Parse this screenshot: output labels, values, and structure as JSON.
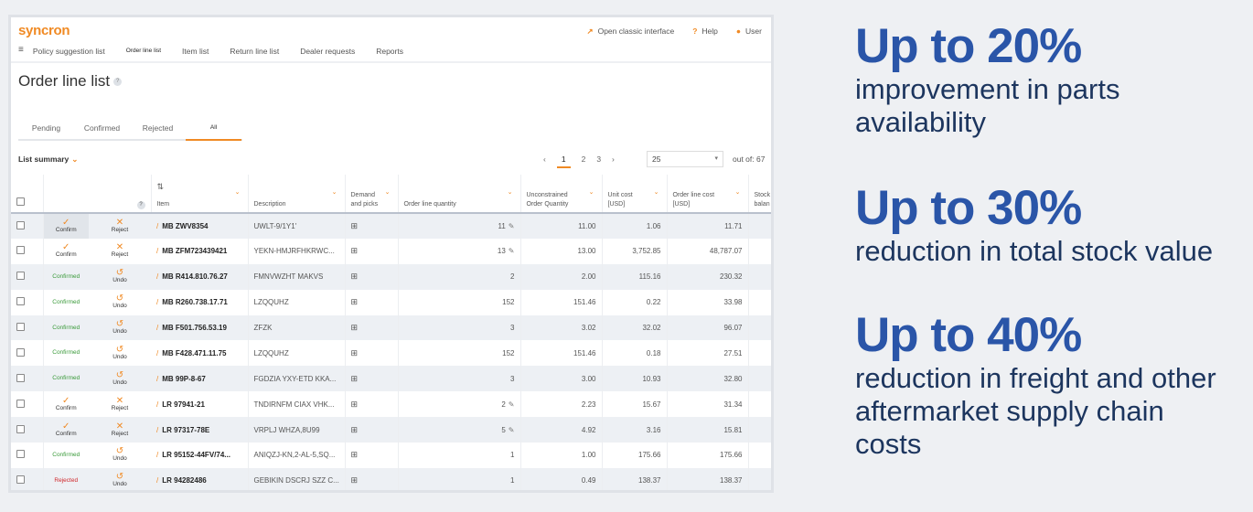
{
  "app": {
    "logo": "syncron",
    "open_classic": "Open classic interface",
    "help": "Help",
    "user": "User"
  },
  "nav": [
    "Policy suggestion list",
    "Order line list",
    "Item list",
    "Return line list",
    "Dealer requests",
    "Reports"
  ],
  "page": {
    "title": "Order line list",
    "help_badge": "?"
  },
  "tabs": [
    "Pending",
    "Confirmed",
    "Rejected",
    "All"
  ],
  "active_tab": "All",
  "list_summary": "List summary",
  "pagination": {
    "pages": [
      "1",
      "2",
      "3"
    ],
    "current": "1",
    "per_page": "25",
    "out_of": "out of: 67"
  },
  "columns": {
    "help": "?",
    "sort": "⇅",
    "item": "Item",
    "description": "Description",
    "demand": "Demand and picks",
    "qty": "Order line quantity",
    "uncons": "Unconstrained Order Quantity",
    "unit": "Unit cost [USD]",
    "cost": "Order line cost [USD]",
    "stock": "Stock balan"
  },
  "labels": {
    "confirm": "Confirm",
    "reject": "Reject",
    "undo": "Undo",
    "confirmed": "Confirmed",
    "rejected": "Rejected"
  },
  "rows": [
    {
      "status": "pending",
      "item": "MB ZWV8354",
      "desc": "UWLT-9/1Y1'",
      "qty": "11",
      "editable": true,
      "uncons": "11.00",
      "unit": "1.06",
      "cost": "11.71"
    },
    {
      "status": "pending",
      "item": "MB ZFM723439421",
      "desc": "YEKN-HMJRFHKRWC...",
      "qty": "13",
      "editable": true,
      "uncons": "13.00",
      "unit": "3,752.85",
      "cost": "48,787.07"
    },
    {
      "status": "confirmed",
      "item": "MB R414.810.76.27",
      "desc": "FMNVWZHT MAKVS",
      "qty": "2",
      "editable": false,
      "uncons": "2.00",
      "unit": "115.16",
      "cost": "230.32"
    },
    {
      "status": "confirmed",
      "item": "MB R260.738.17.71",
      "desc": "LZQQUHZ",
      "qty": "152",
      "editable": false,
      "uncons": "151.46",
      "unit": "0.22",
      "cost": "33.98"
    },
    {
      "status": "confirmed",
      "item": "MB F501.756.53.19",
      "desc": "ZFZK",
      "qty": "3",
      "editable": false,
      "uncons": "3.02",
      "unit": "32.02",
      "cost": "96.07"
    },
    {
      "status": "confirmed",
      "item": "MB F428.471.11.75",
      "desc": "LZQQUHZ",
      "qty": "152",
      "editable": false,
      "uncons": "151.46",
      "unit": "0.18",
      "cost": "27.51"
    },
    {
      "status": "confirmed",
      "item": "MB 99P-8-67",
      "desc": "FGDZIA YXY-ETD KKA...",
      "qty": "3",
      "editable": false,
      "uncons": "3.00",
      "unit": "10.93",
      "cost": "32.80"
    },
    {
      "status": "pending",
      "item": "LR 97941-21",
      "desc": "TNDIRNFM CIAX VHK...",
      "qty": "2",
      "editable": true,
      "uncons": "2.23",
      "unit": "15.67",
      "cost": "31.34"
    },
    {
      "status": "pending",
      "item": "LR 97317-78E",
      "desc": "VRPLJ WHZA,8U99",
      "qty": "5",
      "editable": true,
      "uncons": "4.92",
      "unit": "3.16",
      "cost": "15.81"
    },
    {
      "status": "confirmed",
      "item": "LR 95152-44FV/74...",
      "desc": "ANIQZJ-KN,2-AL-5,SQ...",
      "qty": "1",
      "editable": false,
      "uncons": "1.00",
      "unit": "175.66",
      "cost": "175.66"
    },
    {
      "status": "rejected",
      "item": "LR 94282486",
      "desc": "GEBIKIN DSCRJ SZZ C...",
      "qty": "1",
      "editable": false,
      "uncons": "0.49",
      "unit": "138.37",
      "cost": "138.37"
    }
  ],
  "stats": [
    {
      "headline": "Up to 20%",
      "text": "improvement in parts availability"
    },
    {
      "headline": "Up to 30%",
      "text": "reduction in total stock value"
    },
    {
      "headline": "Up to 40%",
      "text": "reduction in freight and other aftermarket supply chain costs"
    }
  ],
  "colors": {
    "accent": "#f08a24",
    "headline": "#2a55a8",
    "body": "#1c355e",
    "confirmed": "#3a9a3a",
    "rejected": "#d0262a"
  }
}
